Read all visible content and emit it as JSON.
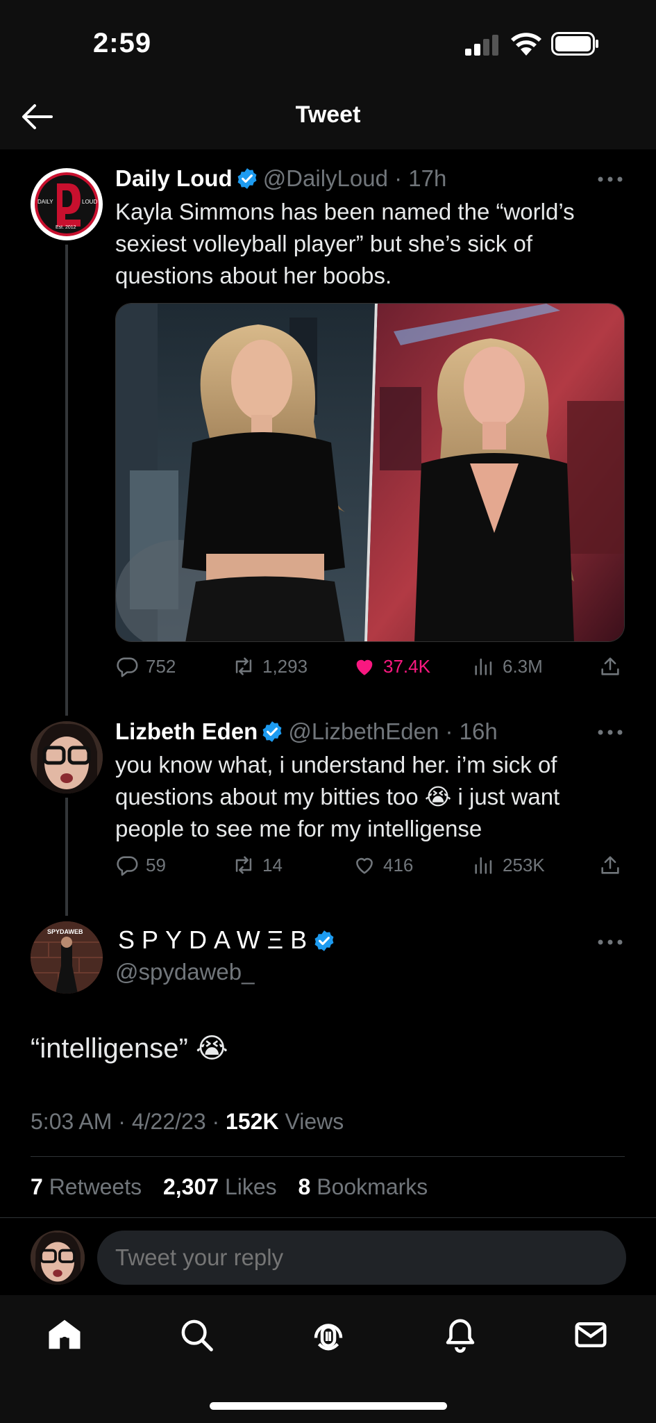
{
  "status_bar": {
    "time": "2:59"
  },
  "header": {
    "title": "Tweet"
  },
  "tweets": [
    {
      "name": "Daily Loud",
      "handle": "@DailyLoud",
      "time": "17h",
      "text": "Kayla Simmons has been named the “world’s sexiest volleyball player” but she’s sick of questions about her boobs.",
      "avatar_text": {
        "left": "DAILY",
        "right": "LOUD",
        "est": "Est. 2012"
      },
      "replies": "752",
      "retweets": "1,293",
      "likes": "37.4K",
      "views": "6.3M",
      "liked": true
    },
    {
      "name": "Lizbeth Eden",
      "handle": "@LizbethEden",
      "time": "16h",
      "text": "you know what, i understand her. i’m sick of questions about my bitties too 😭 i just want people to see me for my intelligense",
      "replies": "59",
      "retweets": "14",
      "likes": "416",
      "views": "253K",
      "liked": false
    }
  ],
  "focused": {
    "name": "SPYDAWΞB",
    "handle": "@spydaweb_",
    "avatar_text": "SPYDAWEB",
    "text": "“intelligense” 😭",
    "time": "5:03 AM",
    "date": "4/22/23",
    "views_count": "152K",
    "views_label": "Views",
    "retweets_count": "7",
    "retweets_label": "Retweets",
    "likes_count": "2,307",
    "likes_label": "Likes",
    "bookmarks_count": "8",
    "bookmarks_label": "Bookmarks"
  },
  "reply": {
    "placeholder": "Tweet your reply"
  },
  "colors": {
    "accent": "#1d9bf0",
    "like": "#f91880",
    "muted": "#71767b"
  },
  "tabs": [
    "home-icon",
    "search-icon",
    "spaces-icon",
    "notifications-icon",
    "messages-icon"
  ]
}
